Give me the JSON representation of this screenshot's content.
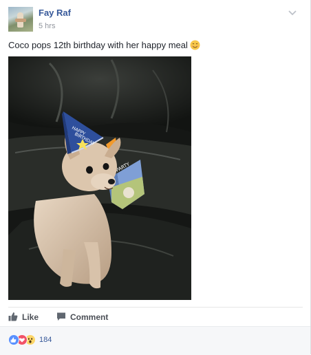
{
  "post": {
    "author": "Fay Raf",
    "timestamp": "5 hrs",
    "message": "Coco pops 12th birthday with her happy meal",
    "message_emoji": "smiling-face-emoji"
  },
  "actions": {
    "like_label": "Like",
    "comment_label": "Comment"
  },
  "reactions": {
    "types": [
      "like",
      "love",
      "wow"
    ],
    "count": "184"
  },
  "colors": {
    "link_blue": "#365899",
    "like_blue": "#5890ff",
    "love_red": "#f25268",
    "wow_yellow": "#fcd669",
    "meta_gray": "#90949c"
  },
  "icons": {
    "options": "chevron-down-icon",
    "like": "thumbs-up-icon",
    "comment": "speech-bubble-icon"
  }
}
